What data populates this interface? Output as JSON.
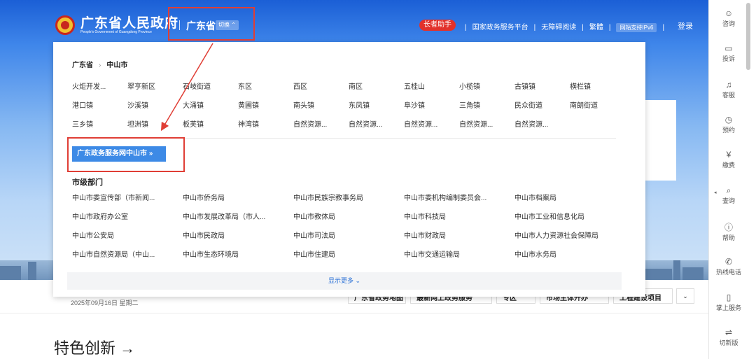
{
  "header": {
    "logo_cn": "广东省人民政府",
    "logo_en": "People's Government of Guangdong Province",
    "province": "广东省",
    "switch_label": "切换 ⌃",
    "elder_label": "长者助手",
    "links": [
      "国家政务服务平台",
      "无障碍阅读",
      "繁體"
    ],
    "ipv6_label": "网站支持IPv6",
    "login_label": "登录"
  },
  "panel": {
    "breadcrumb_province": "广东省",
    "breadcrumb_city": "中山市",
    "towns": [
      "火炬开发...",
      "翠亨新区",
      "石岐街道",
      "东区",
      "西区",
      "南区",
      "五桂山",
      "小榄镇",
      "古镇镇",
      "横栏镇",
      "港口镇",
      "沙溪镇",
      "大涌镇",
      "黄圃镇",
      "南头镇",
      "东凤镇",
      "阜沙镇",
      "三角镇",
      "民众街道",
      "南朗街道",
      "三乡镇",
      "坦洲镇",
      "板芙镇",
      "神湾镇",
      "自然资源...",
      "自然资源...",
      "自然资源...",
      "自然资源...",
      "自然资源..."
    ],
    "service_button": "广东政务服务网中山市 »",
    "dept_title": "市级部门",
    "departments": [
      "中山市委宣传部（市新闻...",
      "中山市侨务局",
      "中山市民族宗教事务局",
      "中山市委机构编制委员会...",
      "中山市档案局",
      "中山市政府办公室",
      "中山市发展改革局（市人...",
      "中山市教体局",
      "中山市科技局",
      "中山市工业和信息化局",
      "中山市公安局",
      "中山市民政局",
      "中山市司法局",
      "中山市财政局",
      "中山市人力资源社会保障局",
      "中山市自然资源局（中山...",
      "中山市生态环境局",
      "中山市住建局",
      "中山市交通运输局",
      "中山市水务局"
    ],
    "show_more": "显示更多 ⌄"
  },
  "page": {
    "date": "2025年09月16日 星期二",
    "quick_buttons": [
      "广东省政务地图",
      "最新网上政务服务",
      "专区",
      "市场主体开办",
      "工程建设项目"
    ],
    "more_icon": "chevron-down-icon",
    "featured_title": "特色创新 →"
  },
  "sidebar": {
    "items": [
      {
        "label": "咨询",
        "icon": "chat-icon"
      },
      {
        "label": "投诉",
        "icon": "complaint-icon"
      },
      {
        "label": "客服",
        "icon": "headset-icon"
      },
      {
        "label": "预约",
        "icon": "clock-icon"
      },
      {
        "label": "缴费",
        "icon": "payment-icon"
      },
      {
        "label": "查询",
        "icon": "search-icon"
      },
      {
        "label": "帮助",
        "icon": "info-icon"
      },
      {
        "label": "热线电话",
        "icon": "phone-icon"
      },
      {
        "label": "掌上服务",
        "icon": "mobile-icon"
      },
      {
        "label": "切新版",
        "icon": "switch-icon"
      }
    ]
  },
  "colors": {
    "accent": "#3d8ae6",
    "highlight": "#e03e35",
    "elder": "#e2312b"
  }
}
